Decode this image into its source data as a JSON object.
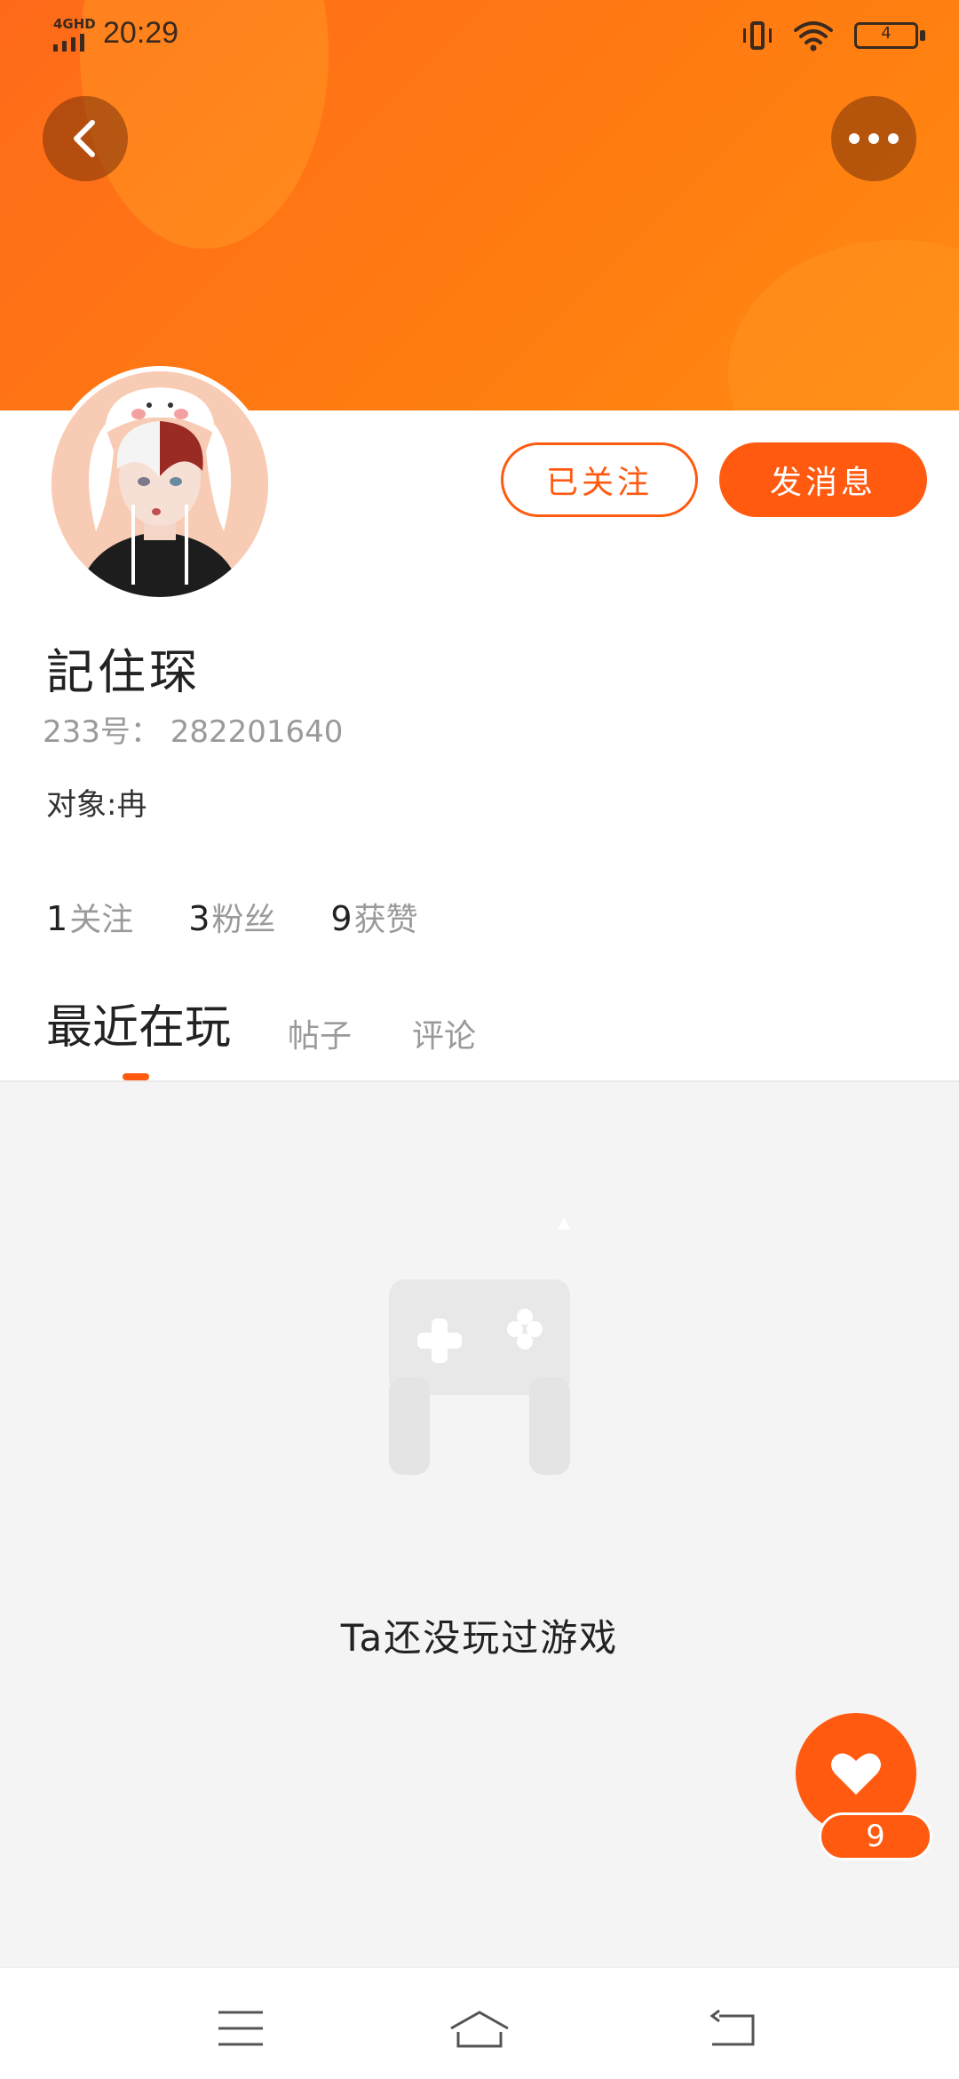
{
  "status_bar": {
    "network": "4GHD",
    "time": "20:29",
    "battery": "4",
    "icons": [
      "vibrate-icon",
      "wifi-icon",
      "battery-icon"
    ]
  },
  "nav": {
    "back_icon": "chevron-left-icon",
    "more_icon": "more-dots-icon"
  },
  "profile": {
    "name": "記住琛",
    "uid": "233号： 282201640",
    "bio": "对象:冉",
    "follow_button": "已关注",
    "message_button": "发消息",
    "stats": [
      {
        "value": "1",
        "label": "关注"
      },
      {
        "value": "3",
        "label": "粉丝"
      },
      {
        "value": "9",
        "label": "获赞"
      }
    ]
  },
  "tabs": [
    {
      "label": "最近在玩",
      "active": true
    },
    {
      "label": "帖子",
      "active": false
    },
    {
      "label": "评论",
      "active": false
    }
  ],
  "empty_state": {
    "icon": "gamepad-icon",
    "text": "Ta还没玩过游戏"
  },
  "like_fab": {
    "icon": "heart-icon",
    "count": "9"
  },
  "bottom_nav": {
    "icons": [
      "menu-icon",
      "home-icon",
      "back-icon"
    ]
  },
  "colors": {
    "accent": "#ff5a10",
    "header_gradient_start": "#ff6a1a",
    "header_gradient_end": "#ff8a10",
    "content_bg": "#f4f4f4"
  }
}
